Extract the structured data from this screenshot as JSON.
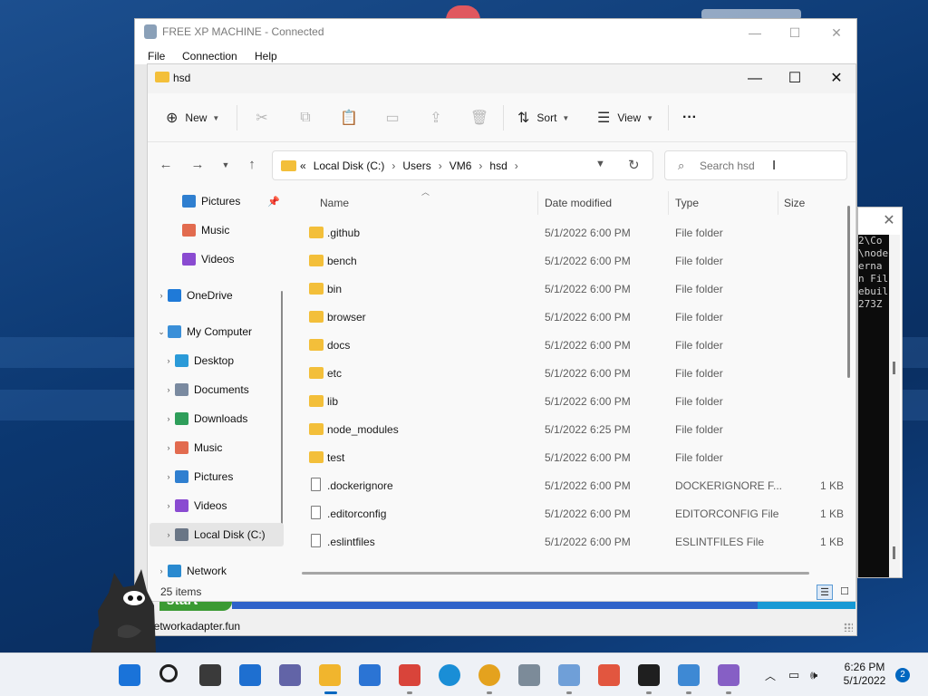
{
  "rdp": {
    "title": "FREE XP MACHINE - Connected",
    "menu": [
      "File",
      "Connection",
      "Help"
    ],
    "status": "networkadapter.fun"
  },
  "explorer": {
    "title": "hsd",
    "commands": {
      "new": "New",
      "sort": "Sort",
      "view": "View",
      "more": "···"
    },
    "address": {
      "overflow": "«",
      "crumbs": [
        "Local Disk (C:)",
        "Users",
        "VM6",
        "hsd"
      ]
    },
    "search": {
      "placeholder": "Search hsd"
    },
    "sidebar": [
      {
        "label": "Pictures",
        "icon": "pictures-icon",
        "color": "#2f7fd0",
        "pinned": true,
        "expand": false
      },
      {
        "label": "Music",
        "icon": "music-icon",
        "color": "#e26b4f",
        "pinned": false,
        "expand": false
      },
      {
        "label": "Videos",
        "icon": "videos-icon",
        "color": "#8a4bd1",
        "pinned": false,
        "expand": false
      },
      {
        "label": "OneDrive",
        "icon": "onedrive-icon",
        "color": "#1f7ad8",
        "pinned": false,
        "expand": true
      },
      {
        "label": "My Computer",
        "icon": "computer-icon",
        "color": "#3a8fd8",
        "pinned": false,
        "expand": true,
        "open": true
      },
      {
        "label": "Desktop",
        "icon": "desktop-icon",
        "color": "#2a9ad8",
        "pinned": false,
        "expand": true
      },
      {
        "label": "Documents",
        "icon": "documents-icon",
        "color": "#7a8aa0",
        "pinned": false,
        "expand": true
      },
      {
        "label": "Downloads",
        "icon": "downloads-icon",
        "color": "#2e9e5a",
        "pinned": false,
        "expand": true
      },
      {
        "label": "Music",
        "icon": "music-icon",
        "color": "#e26b4f",
        "pinned": false,
        "expand": true
      },
      {
        "label": "Pictures",
        "icon": "pictures-icon",
        "color": "#2f7fd0",
        "pinned": false,
        "expand": true
      },
      {
        "label": "Videos",
        "icon": "videos-icon",
        "color": "#8a4bd1",
        "pinned": false,
        "expand": true
      },
      {
        "label": "Local Disk (C:)",
        "icon": "drive-icon",
        "color": "#6a7686",
        "pinned": false,
        "expand": true,
        "selected": true
      },
      {
        "label": "Network",
        "icon": "network-icon",
        "color": "#2a8ad0",
        "pinned": false,
        "expand": true
      }
    ],
    "columns": {
      "name": "Name",
      "date": "Date modified",
      "type": "Type",
      "size": "Size"
    },
    "files": [
      {
        "name": ".github",
        "date": "5/1/2022 6:00 PM",
        "type": "File folder",
        "size": "",
        "kind": "folder"
      },
      {
        "name": "bench",
        "date": "5/1/2022 6:00 PM",
        "type": "File folder",
        "size": "",
        "kind": "folder"
      },
      {
        "name": "bin",
        "date": "5/1/2022 6:00 PM",
        "type": "File folder",
        "size": "",
        "kind": "folder"
      },
      {
        "name": "browser",
        "date": "5/1/2022 6:00 PM",
        "type": "File folder",
        "size": "",
        "kind": "folder"
      },
      {
        "name": "docs",
        "date": "5/1/2022 6:00 PM",
        "type": "File folder",
        "size": "",
        "kind": "folder"
      },
      {
        "name": "etc",
        "date": "5/1/2022 6:00 PM",
        "type": "File folder",
        "size": "",
        "kind": "folder"
      },
      {
        "name": "lib",
        "date": "5/1/2022 6:00 PM",
        "type": "File folder",
        "size": "",
        "kind": "folder"
      },
      {
        "name": "node_modules",
        "date": "5/1/2022 6:25 PM",
        "type": "File folder",
        "size": "",
        "kind": "folder"
      },
      {
        "name": "test",
        "date": "5/1/2022 6:00 PM",
        "type": "File folder",
        "size": "",
        "kind": "folder"
      },
      {
        "name": ".dockerignore",
        "date": "5/1/2022 6:00 PM",
        "type": "DOCKERIGNORE F...",
        "size": "1 KB",
        "kind": "file"
      },
      {
        "name": ".editorconfig",
        "date": "5/1/2022 6:00 PM",
        "type": "EDITORCONFIG File",
        "size": "1 KB",
        "kind": "file"
      },
      {
        "name": ".eslintfiles",
        "date": "5/1/2022 6:00 PM",
        "type": "ESLINTFILES File",
        "size": "1 KB",
        "kind": "file"
      }
    ],
    "status": {
      "count": "25 items"
    }
  },
  "terminal": {
    "lines": [
      "",
      "",
      "2\\Co",
      "",
      "\\node",
      "",
      "",
      "erna",
      "",
      "",
      "n Fil",
      "ebuil",
      "",
      "",
      "",
      "",
      "",
      "",
      "",
      "273Z"
    ]
  },
  "taskbar": {
    "apps": [
      "start-icon",
      "search-icon",
      "task-view-icon",
      "widgets-icon",
      "teams-chat-icon",
      "file-explorer-icon",
      "microsoft-store-icon",
      "remote-desktop-icon",
      "edge-icon",
      "chrome-icon",
      "notepad-app-icon",
      "network-app-icon",
      "paint-app-icon",
      "terminal-icon",
      "notepad-icon",
      "visual-studio-icon"
    ],
    "time": "6:26 PM",
    "date": "5/1/2022",
    "notifications": "2"
  }
}
